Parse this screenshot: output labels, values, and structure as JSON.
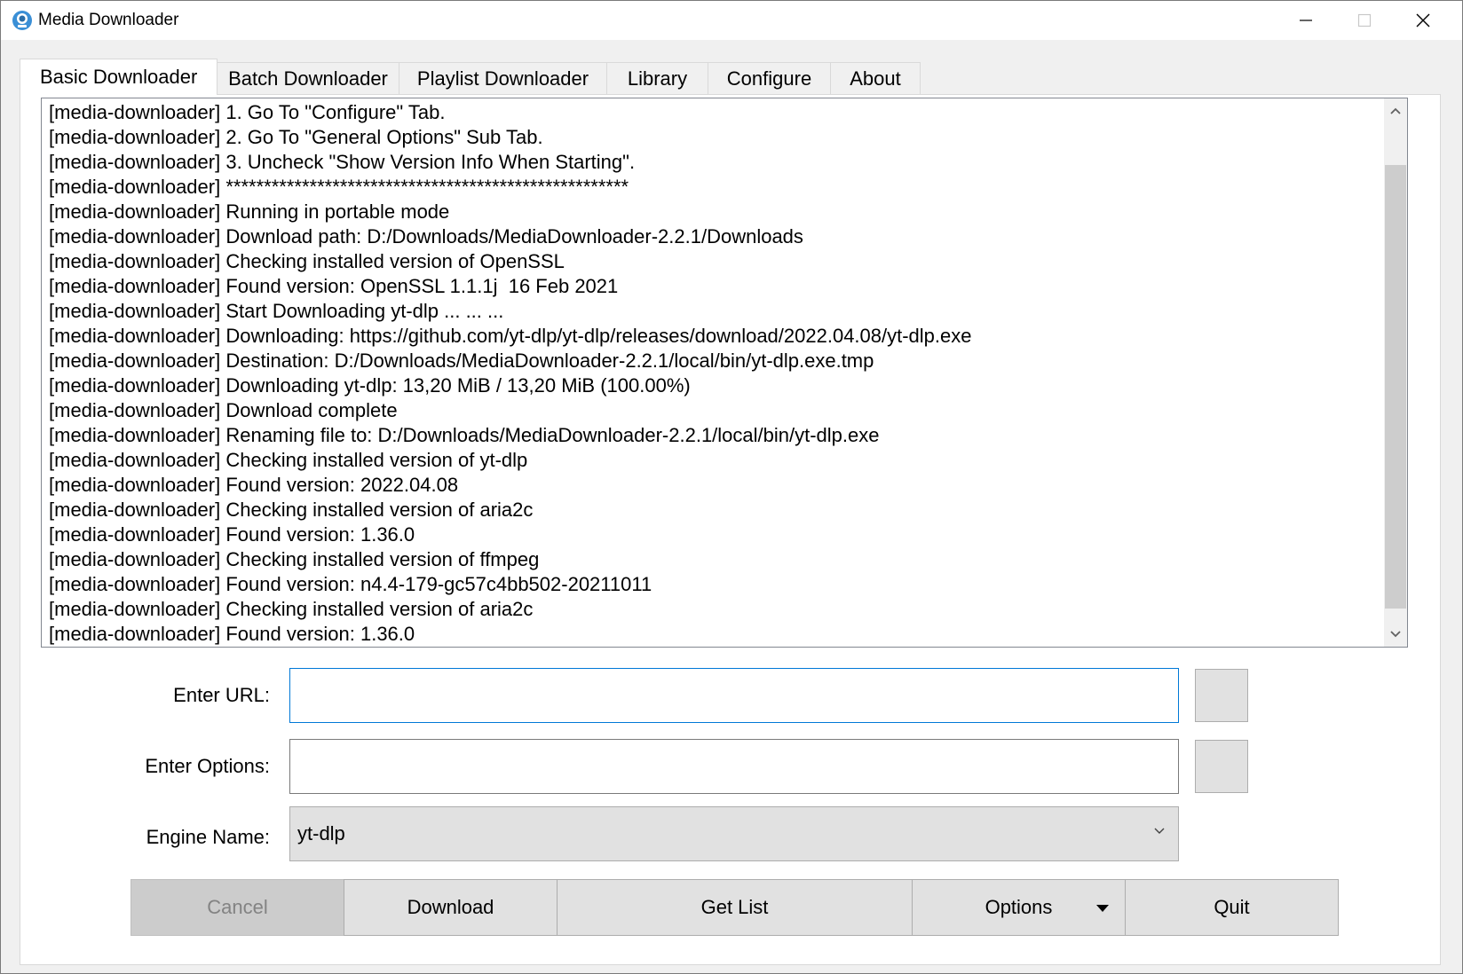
{
  "window": {
    "title": "Media Downloader",
    "controls": [
      "minimize",
      "maximize",
      "close"
    ]
  },
  "tabs": [
    {
      "label": "Basic Downloader",
      "active": true
    },
    {
      "label": "Batch Downloader",
      "active": false
    },
    {
      "label": "Playlist Downloader",
      "active": false
    },
    {
      "label": "Library",
      "active": false
    },
    {
      "label": "Configure",
      "active": false
    },
    {
      "label": "About",
      "active": false
    }
  ],
  "log": {
    "lines": [
      "[media-downloader] 1. Go To \"Configure\" Tab.",
      "[media-downloader] 2. Go To \"General Options\" Sub Tab.",
      "[media-downloader] 3. Uncheck \"Show Version Info When Starting\".",
      "[media-downloader] *****************************************************",
      "[media-downloader] Running in portable mode",
      "[media-downloader] Download path: D:/Downloads/MediaDownloader-2.2.1/Downloads",
      "[media-downloader] Checking installed version of OpenSSL",
      "[media-downloader] Found version: OpenSSL 1.1.1j  16 Feb 2021",
      "[media-downloader] Start Downloading yt-dlp ... ... ...",
      "[media-downloader] Downloading: https://github.com/yt-dlp/yt-dlp/releases/download/2022.04.08/yt-dlp.exe",
      "[media-downloader] Destination: D:/Downloads/MediaDownloader-2.2.1/local/bin/yt-dlp.exe.tmp",
      "[media-downloader] Downloading yt-dlp: 13,20 MiB / 13,20 MiB (100.00%)",
      "[media-downloader] Download complete",
      "[media-downloader] Renaming file to: D:/Downloads/MediaDownloader-2.2.1/local/bin/yt-dlp.exe",
      "[media-downloader] Checking installed version of yt-dlp",
      "[media-downloader] Found version: 2022.04.08",
      "[media-downloader] Checking installed version of aria2c",
      "[media-downloader] Found version: 1.36.0",
      "[media-downloader] Checking installed version of ffmpeg",
      "[media-downloader] Found version: n4.4-179-gc57c4bb502-20211011",
      "[media-downloader] Checking installed version of aria2c",
      "[media-downloader] Found version: 1.36.0"
    ]
  },
  "form": {
    "url_label": "Enter URL:",
    "url_value": "",
    "options_label": "Enter Options:",
    "options_value": "",
    "engine_label": "Engine Name:",
    "engine_value": "yt-dlp"
  },
  "buttons": {
    "cancel": "Cancel",
    "download": "Download",
    "get_list": "Get List",
    "options": "Options",
    "quit": "Quit"
  },
  "colors": {
    "focus_border": "#0078d7",
    "button_face": "#e1e1e1",
    "disabled_face": "#cccccc"
  }
}
